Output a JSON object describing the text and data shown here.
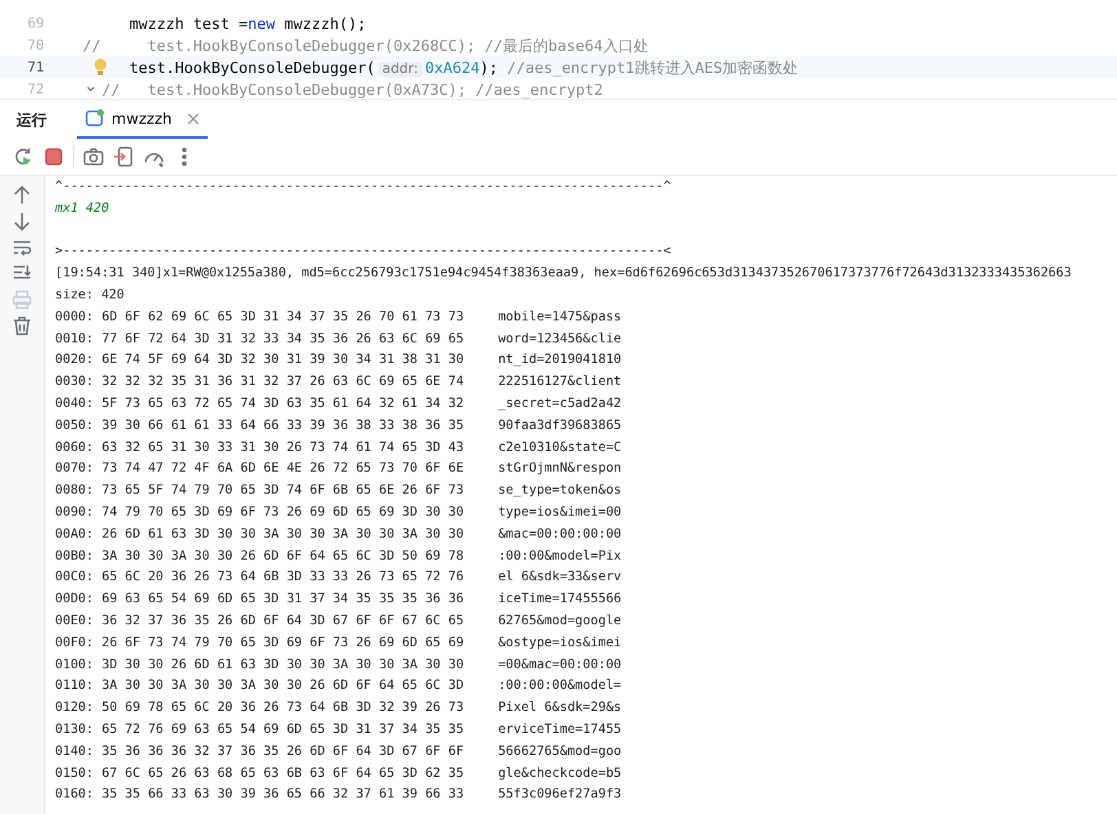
{
  "editor": {
    "lines": [
      {
        "number": "69",
        "current": false,
        "bulb": false,
        "fold": false,
        "segments": [
          {
            "kind": "plain",
            "text": "mwzzzh test ="
          },
          {
            "kind": "keyword",
            "text": "new"
          },
          {
            "kind": "plain",
            "text": " mwzzzh();"
          }
        ]
      },
      {
        "number": "70",
        "current": false,
        "gutter": "//",
        "bulb": false,
        "fold": false,
        "segments": [
          {
            "kind": "comment",
            "text": "  test.HookByConsoleDebugger(0x268CC); //最后的base64入口处"
          }
        ]
      },
      {
        "number": "71",
        "current": true,
        "bulb": true,
        "fold": false,
        "segments": [
          {
            "kind": "plain",
            "text": "test.HookByConsoleDebugger("
          },
          {
            "kind": "hint",
            "text": "addr:"
          },
          {
            "kind": "number",
            "text": "0xA624"
          },
          {
            "kind": "plain",
            "text": "); "
          },
          {
            "kind": "comment",
            "text": "//aes_encrypt1跳转进入AES加密函数处"
          }
        ]
      },
      {
        "number": "72",
        "current": false,
        "gutter": "//",
        "bulb": false,
        "fold": true,
        "segments": [
          {
            "kind": "comment",
            "text": "  test.HookByConsoleDebugger(0xA73C); //aes_encrypt2"
          }
        ]
      }
    ]
  },
  "run_panel": {
    "title": "运行",
    "tabs": [
      {
        "label": "mwzzzh",
        "selected": true
      }
    ]
  },
  "console": {
    "lines": [
      {
        "kind": "separator",
        "text": "^------------------------------------------------------------------------------^"
      },
      {
        "kind": "output",
        "text": "mx1 420"
      },
      {
        "kind": "blank"
      },
      {
        "kind": "separator",
        "text": ">------------------------------------------------------------------------------<"
      },
      {
        "kind": "log",
        "text": "[19:54:31 340]x1=RW@0x1255a380, md5=6cc256793c1751e94c9454f38363eaa9, hex=6d6f62696c653d313437352670617373776f72643d3132333435362663"
      },
      {
        "kind": "log",
        "text": "size: 420"
      },
      {
        "kind": "hex",
        "offset": "0000:",
        "bytes": "6D 6F 62 69 6C 65 3D 31 34 37 35 26 70 61 73 73",
        "ascii": "mobile=1475&pass"
      },
      {
        "kind": "hex",
        "offset": "0010:",
        "bytes": "77 6F 72 64 3D 31 32 33 34 35 36 26 63 6C 69 65",
        "ascii": "word=123456&clie"
      },
      {
        "kind": "hex",
        "offset": "0020:",
        "bytes": "6E 74 5F 69 64 3D 32 30 31 39 30 34 31 38 31 30",
        "ascii": "nt_id=2019041810"
      },
      {
        "kind": "hex",
        "offset": "0030:",
        "bytes": "32 32 32 35 31 36 31 32 37 26 63 6C 69 65 6E 74",
        "ascii": "222516127&client"
      },
      {
        "kind": "hex",
        "offset": "0040:",
        "bytes": "5F 73 65 63 72 65 74 3D 63 35 61 64 32 61 34 32",
        "ascii": "_secret=c5ad2a42"
      },
      {
        "kind": "hex",
        "offset": "0050:",
        "bytes": "39 30 66 61 61 33 64 66 33 39 36 38 33 38 36 35",
        "ascii": "90faa3df39683865"
      },
      {
        "kind": "hex",
        "offset": "0060:",
        "bytes": "63 32 65 31 30 33 31 30 26 73 74 61 74 65 3D 43",
        "ascii": "c2e10310&state=C"
      },
      {
        "kind": "hex",
        "offset": "0070:",
        "bytes": "73 74 47 72 4F 6A 6D 6E 4E 26 72 65 73 70 6F 6E",
        "ascii": "stGrOjmnN&respon"
      },
      {
        "kind": "hex",
        "offset": "0080:",
        "bytes": "73 65 5F 74 79 70 65 3D 74 6F 6B 65 6E 26 6F 73",
        "ascii": "se_type=token&os"
      },
      {
        "kind": "hex",
        "offset": "0090:",
        "bytes": "74 79 70 65 3D 69 6F 73 26 69 6D 65 69 3D 30 30",
        "ascii": "type=ios&imei=00"
      },
      {
        "kind": "hex",
        "offset": "00A0:",
        "bytes": "26 6D 61 63 3D 30 30 3A 30 30 3A 30 30 3A 30 30",
        "ascii": "&mac=00:00:00:00"
      },
      {
        "kind": "hex",
        "offset": "00B0:",
        "bytes": "3A 30 30 3A 30 30 26 6D 6F 64 65 6C 3D 50 69 78",
        "ascii": ":00:00&model=Pix"
      },
      {
        "kind": "hex",
        "offset": "00C0:",
        "bytes": "65 6C 20 36 26 73 64 6B 3D 33 33 26 73 65 72 76",
        "ascii": "el 6&sdk=33&serv"
      },
      {
        "kind": "hex",
        "offset": "00D0:",
        "bytes": "69 63 65 54 69 6D 65 3D 31 37 34 35 35 35 36 36",
        "ascii": "iceTime=17455566"
      },
      {
        "kind": "hex",
        "offset": "00E0:",
        "bytes": "36 32 37 36 35 26 6D 6F 64 3D 67 6F 6F 67 6C 65",
        "ascii": "62765&mod=google"
      },
      {
        "kind": "hex",
        "offset": "00F0:",
        "bytes": "26 6F 73 74 79 70 65 3D 69 6F 73 26 69 6D 65 69",
        "ascii": "&ostype=ios&imei"
      },
      {
        "kind": "hex",
        "offset": "0100:",
        "bytes": "3D 30 30 26 6D 61 63 3D 30 30 3A 30 30 3A 30 30",
        "ascii": "=00&mac=00:00:00"
      },
      {
        "kind": "hex",
        "offset": "0110:",
        "bytes": "3A 30 30 3A 30 30 3A 30 30 26 6D 6F 64 65 6C 3D",
        "ascii": ":00:00:00&model="
      },
      {
        "kind": "hex",
        "offset": "0120:",
        "bytes": "50 69 78 65 6C 20 36 26 73 64 6B 3D 32 39 26 73",
        "ascii": "Pixel 6&sdk=29&s"
      },
      {
        "kind": "hex",
        "offset": "0130:",
        "bytes": "65 72 76 69 63 65 54 69 6D 65 3D 31 37 34 35 35",
        "ascii": "erviceTime=17455"
      },
      {
        "kind": "hex",
        "offset": "0140:",
        "bytes": "35 36 36 36 32 37 36 35 26 6D 6F 64 3D 67 6F 6F",
        "ascii": "56662765&mod=goo"
      },
      {
        "kind": "hex",
        "offset": "0150:",
        "bytes": "67 6C 65 26 63 68 65 63 6B 63 6F 64 65 3D 62 35",
        "ascii": "gle&checkcode=b5"
      },
      {
        "kind": "hex",
        "offset": "0160:",
        "bytes": "35 35 66 33 63 30 39 36 65 66 32 37 61 39 66 33",
        "ascii": "55f3c096ef27a9f3"
      }
    ]
  }
}
